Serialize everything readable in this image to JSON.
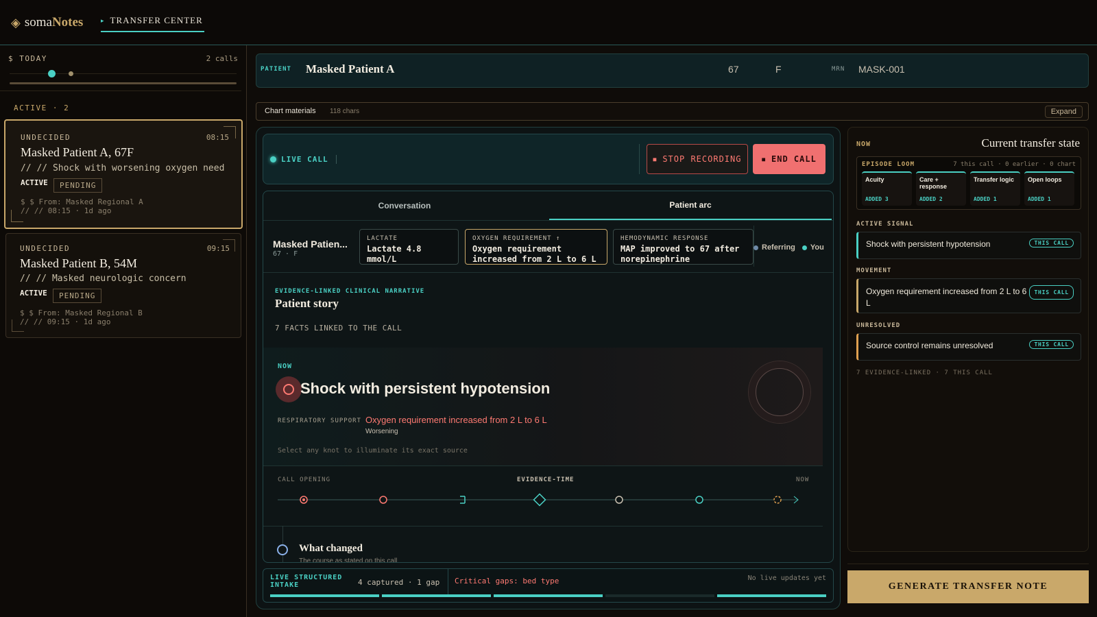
{
  "brand": {
    "prefix": "soma",
    "suffix": "Notes"
  },
  "nav": {
    "tab": "TRANSFER CENTER"
  },
  "sidebar": {
    "today_label": "$ TODAY",
    "calls_count": "2 calls",
    "active_label": "ACTIVE · 2",
    "cards": [
      {
        "status": "UNDECIDED",
        "time": "08:15",
        "name": "Masked Patient A, 67F",
        "concern": "// // Shock with worsening oxygen need",
        "state": "ACTIVE",
        "badge": "PENDING",
        "from": "$ $ From: Masked Regional A",
        "ago": "// // 08:15 · 1d ago"
      },
      {
        "status": "UNDECIDED",
        "time": "09:15",
        "name": "Masked Patient B, 54M",
        "concern": "// // Masked neurologic concern",
        "state": "ACTIVE",
        "badge": "PENDING",
        "from": "$ $ From: Masked Regional B",
        "ago": "// // 09:15 · 1d ago"
      }
    ]
  },
  "header": {
    "patient_label": "PATIENT",
    "patient_name": "Masked Patient A",
    "age": "67",
    "sex": "F",
    "mrn_label": "MRN",
    "mrn": "MASK-001"
  },
  "chart_materials": {
    "label": "Chart materials",
    "chars": "118 chars",
    "expand": "Expand"
  },
  "live": {
    "label": "LIVE CALL",
    "stop": "STOP RECORDING",
    "end": "END CALL"
  },
  "tabs": [
    "Conversation",
    "Patient arc"
  ],
  "arc": {
    "name": "Masked Patien...",
    "sub": "67 · F",
    "chips": [
      {
        "head": "LACTATE",
        "value": "Lactate 4.8 mmol/L"
      },
      {
        "head": "OXYGEN REQUIREMENT ↑",
        "value": "Oxygen requirement increased from 2 L to 6 L"
      },
      {
        "head": "HEMODYNAMIC RESPONSE",
        "value": "MAP improved to 67 after norepinephrine"
      }
    ],
    "legend": [
      "Referring",
      "You"
    ]
  },
  "story": {
    "kicker": "EVIDENCE-LINKED CLINICAL NARRATIVE",
    "title": "Patient story",
    "facts": "7 FACTS LINKED TO THE CALL"
  },
  "now": {
    "label": "NOW",
    "headline": "Shock with persistent hypotension",
    "support_label": "RESPIRATORY SUPPORT",
    "support_value": "Oxygen requirement increased from 2 L to 6 L",
    "trend": "Worsening",
    "hint": "Select any knot to illuminate its exact source"
  },
  "timeline": {
    "start": "CALL OPENING",
    "middle": "EVIDENCE-TIME",
    "end": "NOW"
  },
  "changed": {
    "title": "What changed",
    "sub": "The course as stated on this call"
  },
  "intake": {
    "title1": "LIVE STRUCTURED",
    "title2": "INTAKE",
    "captured": "4 captured · 1 gap",
    "gaps": "Critical gaps: bed type",
    "updates": "No live updates yet"
  },
  "right": {
    "now_label": "NOW",
    "title": "Current transfer state",
    "loom_label": "EPISODE LOOM",
    "loom_meta": "7 this call · 0 earlier · 0 chart",
    "loom": [
      {
        "name": "Acuity",
        "added": "ADDED 3"
      },
      {
        "name": "Care + response",
        "added": "ADDED 2"
      },
      {
        "name": "Transfer logic",
        "added": "ADDED 1"
      },
      {
        "name": "Open loops",
        "added": "ADDED 1"
      }
    ],
    "active_label": "ACTIVE SIGNAL",
    "active_text": "Shock with persistent hypotension",
    "movement_label": "MOVEMENT",
    "movement_text": "Oxygen requirement increased from 2 L to 6 L",
    "unresolved_label": "UNRESOLVED",
    "unresolved_text": "Source control remains unresolved",
    "this_call": "THIS CALL",
    "footer": "7 EVIDENCE-LINKED · 7 THIS CALL"
  },
  "generate": "GENERATE TRANSFER NOTE",
  "colors": {
    "accent": "#4ad0c4",
    "gold": "#c9a86a",
    "alert": "#f07070",
    "bg": "#0f0c09"
  }
}
